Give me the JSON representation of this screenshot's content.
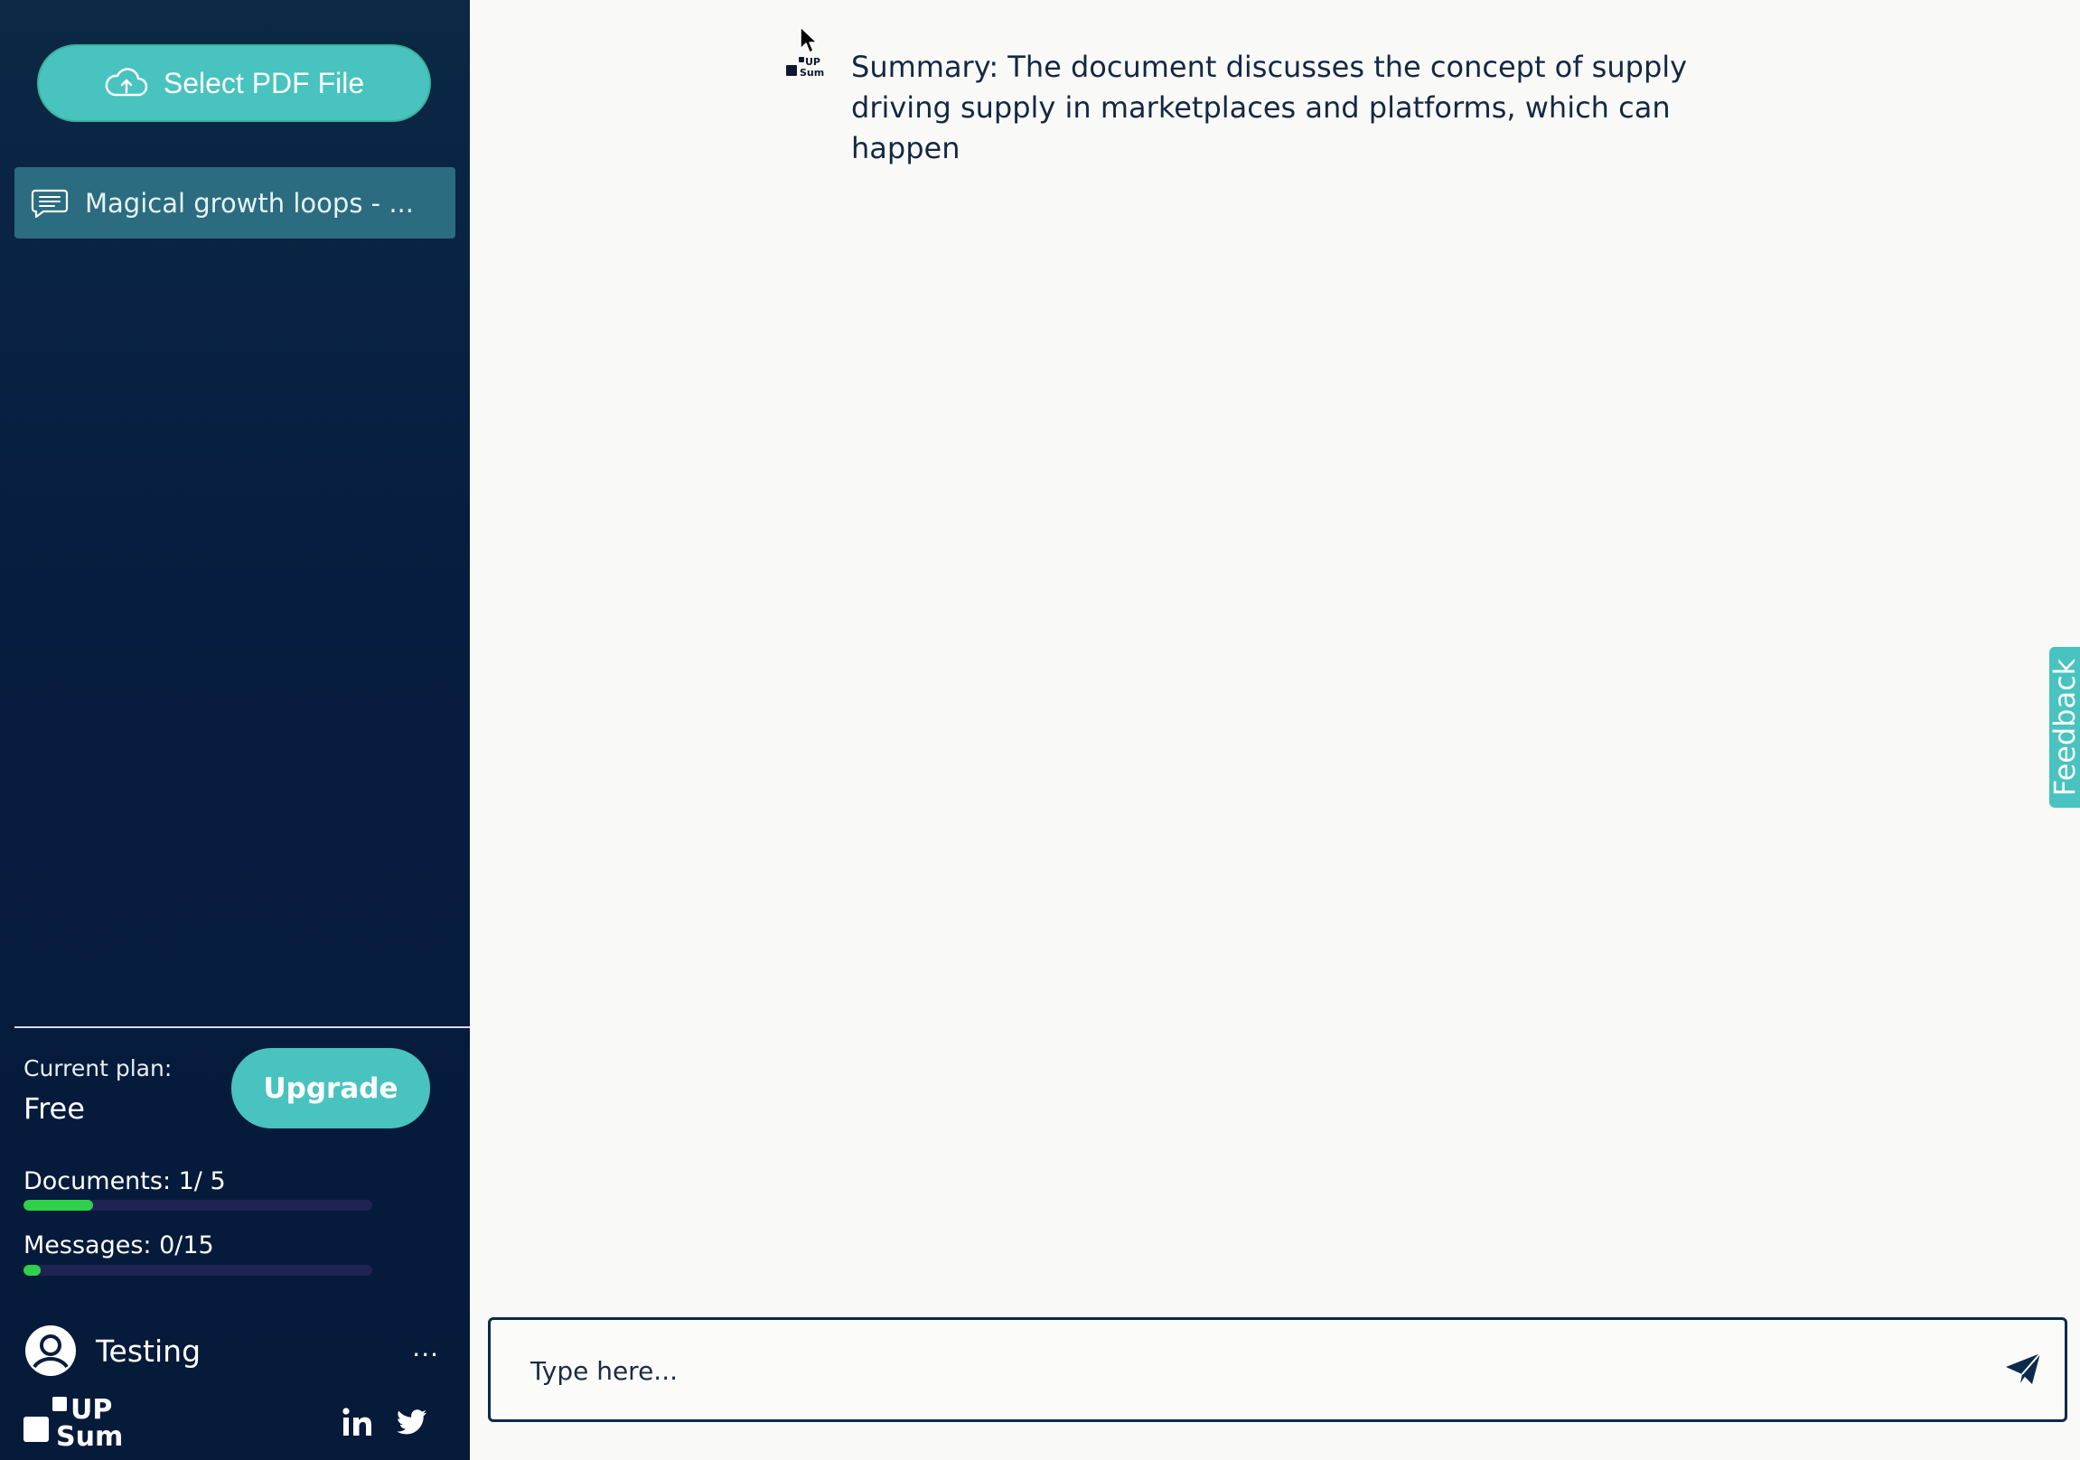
{
  "sidebar": {
    "upload_label": "Select PDF File",
    "documents": [
      {
        "label": "Magical growth loops - ..."
      }
    ],
    "plan": {
      "label": "Current plan:",
      "value": "Free",
      "upgrade_label": "Upgrade"
    },
    "usage": {
      "documents_label": "Documents: 1/ 5",
      "documents_fraction": 0.2,
      "messages_label": "Messages: 0/15",
      "messages_fraction": 0.05
    },
    "user": {
      "name": "Testing",
      "more_label": "..."
    },
    "brand": {
      "logo_text_top": "UP",
      "logo_text_bottom": "Sum"
    },
    "social": [
      "linkedin-icon",
      "twitter-icon"
    ]
  },
  "chat": {
    "messages": [
      {
        "text": "Summary: The document discusses the concept of supply driving supply in marketplaces and platforms, which can happen"
      }
    ],
    "input_placeholder": "Type here...",
    "feedback_label": "Feedback"
  },
  "colors": {
    "sidebar_bg": "#071d3f",
    "accent": "#48c3bf",
    "doc_item_bg": "#2b6c80",
    "progress_fill": "#2fd04a",
    "progress_track": "#1f2352",
    "main_bg": "#f9f9f8"
  }
}
